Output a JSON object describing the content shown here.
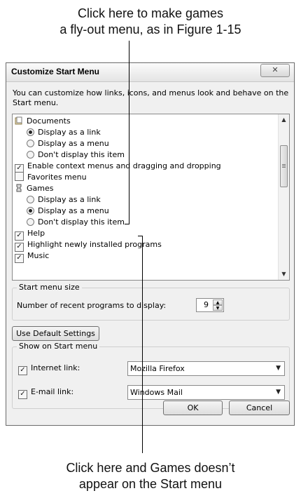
{
  "annotations": {
    "top_line1": "Click here to make games",
    "top_line2": "a fly-out menu, as in Figure 1-15",
    "bottom_line1": "Click here and Games doesn’t",
    "bottom_line2": "appear on the Start menu"
  },
  "dialog": {
    "title": "Customize Start Menu",
    "close_glyph": "✕",
    "description": "You can customize how links, icons, and menus look and behave on the Start menu."
  },
  "list": {
    "documents": "Documents",
    "doc_link": "Display as a link",
    "doc_menu": "Display as a menu",
    "doc_hide": "Don't display this item",
    "context_menus": "Enable context menus and dragging and dropping",
    "favorites": "Favorites menu",
    "games": "Games",
    "games_link": "Display as a link",
    "games_menu": "Display as a menu",
    "games_hide": "Don't display this item",
    "help": "Help",
    "highlight": "Highlight newly installed programs",
    "more": "Music"
  },
  "start_menu_size": {
    "title": "Start menu size",
    "label": "Number of recent programs to display:",
    "value": "9"
  },
  "use_default_label": "Use Default Settings",
  "show_on_start": {
    "title": "Show on Start menu",
    "internet_label": "Internet link:",
    "internet_value": "Mozilla Firefox",
    "email_label": "E-mail link:",
    "email_value": "Windows Mail"
  },
  "buttons": {
    "ok": "OK",
    "cancel": "Cancel"
  },
  "check_glyph": "✓"
}
